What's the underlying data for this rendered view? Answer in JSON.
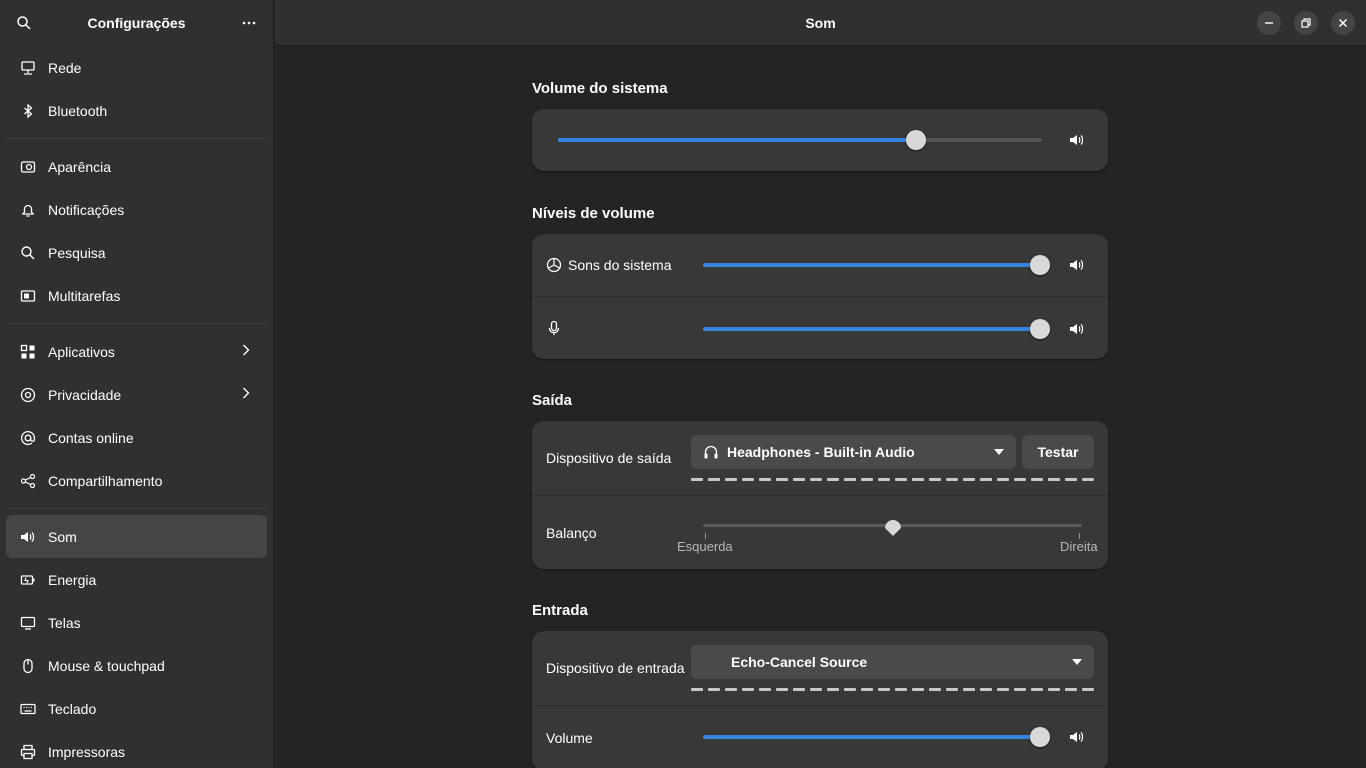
{
  "sidebar": {
    "title": "Configurações",
    "groups": [
      [
        {
          "label": "Rede",
          "icon": "network-icon"
        },
        {
          "label": "Bluetooth",
          "icon": "bluetooth-icon"
        }
      ],
      [
        {
          "label": "Aparência",
          "icon": "appearance-icon"
        },
        {
          "label": "Notificações",
          "icon": "bell-icon"
        },
        {
          "label": "Pesquisa",
          "icon": "search-icon"
        },
        {
          "label": "Multitarefas",
          "icon": "multitasking-icon"
        }
      ],
      [
        {
          "label": "Aplicativos",
          "icon": "apps-icon",
          "chevron": true
        },
        {
          "label": "Privacidade",
          "icon": "privacy-icon",
          "chevron": true
        },
        {
          "label": "Contas online",
          "icon": "at-icon"
        },
        {
          "label": "Compartilhamento",
          "icon": "share-icon"
        }
      ],
      [
        {
          "label": "Som",
          "icon": "speaker-icon",
          "active": true
        },
        {
          "label": "Energia",
          "icon": "power-icon"
        },
        {
          "label": "Telas",
          "icon": "display-icon"
        },
        {
          "label": "Mouse & touchpad",
          "icon": "mouse-icon"
        },
        {
          "label": "Teclado",
          "icon": "keyboard-icon"
        },
        {
          "label": "Impressoras",
          "icon": "printer-icon"
        }
      ]
    ]
  },
  "header": {
    "title": "Som"
  },
  "sections": {
    "system_volume": {
      "title": "Volume do sistema",
      "value": 0.74
    },
    "volume_levels": {
      "title": "Níveis de volume",
      "system_sounds_label": "Sons do sistema",
      "system_sounds_value": 1.0,
      "mic_value": 1.0
    },
    "output": {
      "title": "Saída",
      "device_label": "Dispositivo de saída",
      "device_value": "Headphones - Built-in Audio",
      "test_button": "Testar",
      "balance_label": "Balanço",
      "balance_left": "Esquerda",
      "balance_right": "Direita",
      "balance_value": 0.5
    },
    "input": {
      "title": "Entrada",
      "device_label": "Dispositivo de entrada",
      "device_value": "Echo-Cancel Source",
      "volume_label": "Volume",
      "volume_value": 1.0
    }
  },
  "colors": {
    "accent": "#3584e4",
    "sidebar_bg": "#303030",
    "content_bg": "#242424",
    "card_bg": "#383838"
  }
}
